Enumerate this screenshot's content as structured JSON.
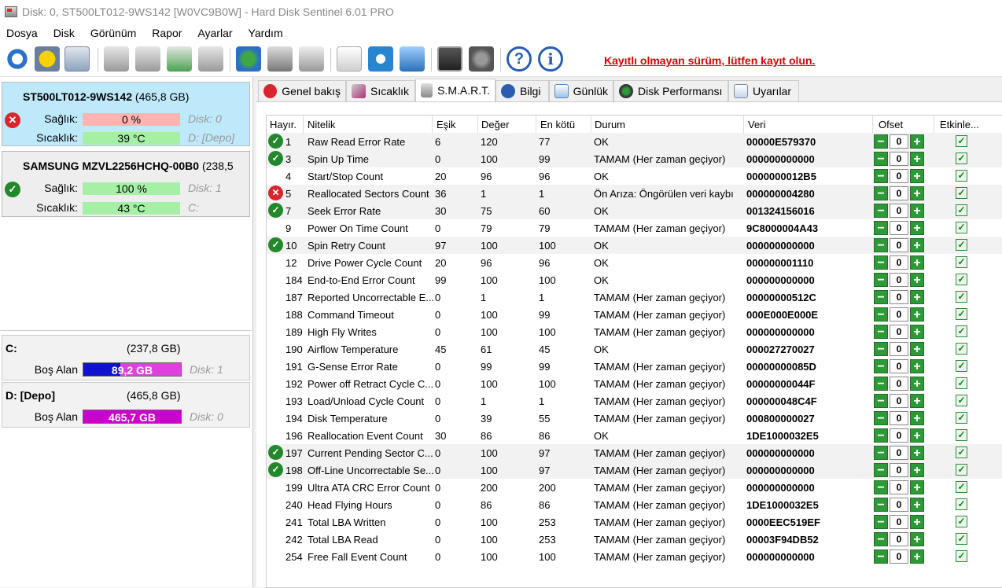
{
  "window": {
    "title": "Disk: 0, ST500LT012-9WS142 [W0VC9B0W]  -  Hard Disk Sentinel 6.01 PRO"
  },
  "menu": [
    "Dosya",
    "Disk",
    "Görünüm",
    "Rapor",
    "Ayarlar",
    "Yardım"
  ],
  "toolbar": {
    "register_text": "Kayıtlı olmayan sürüm, lütfen kayıt olun."
  },
  "disks": [
    {
      "name": "ST500LT012-9WS142",
      "size": "(465,8 GB)",
      "health_label": "Sağlık:",
      "health_value": "0 %",
      "health_disk": "Disk: 0",
      "temp_label": "Sıcaklık:",
      "temp_value": "39 °C",
      "temp_drive": "D: [Depo]",
      "status_icon": "error-icon"
    },
    {
      "name": "SAMSUNG MZVL2256HCHQ-00B0",
      "size": "(238,5",
      "health_label": "Sağlık:",
      "health_value": "100 %",
      "health_disk": "Disk: 1",
      "temp_label": "Sıcaklık:",
      "temp_value": "43 °C",
      "temp_drive": "C:",
      "status_icon": "ok-icon"
    }
  ],
  "volumes": [
    {
      "name": "C:",
      "size": "(237,8 GB)",
      "free_label": "Boş Alan",
      "free_value": "89,2 GB",
      "disk": "Disk: 1",
      "color": "#0000cc"
    },
    {
      "name": "D: [Depo]",
      "size": "(465,8 GB)",
      "free_label": "Boş Alan",
      "free_value": "465,7 GB",
      "disk": "Disk: 0",
      "color": "#cc00cc"
    }
  ],
  "tabs": [
    "Genel bakış",
    "Sıcaklık",
    "S.M.A.R.T.",
    "Bilgi",
    "Günlük",
    "Disk Performansı",
    "Uyarılar"
  ],
  "columns": [
    "Hayır.",
    "Nitelik",
    "Eşik",
    "Değer",
    "En kötü",
    "Durum",
    "Veri",
    "Ofset",
    "Etkinle..."
  ],
  "rows": [
    {
      "icon": "ok",
      "no": "1",
      "name": "Raw Read Error Rate",
      "thr": "6",
      "val": "120",
      "worst": "77",
      "status": "OK",
      "data": "00000E579370"
    },
    {
      "icon": "ok",
      "no": "3",
      "name": "Spin Up Time",
      "thr": "0",
      "val": "100",
      "worst": "99",
      "status": "TAMAM (Her zaman geçiyor)",
      "data": "000000000000"
    },
    {
      "icon": "",
      "no": "4",
      "name": "Start/Stop Count",
      "thr": "20",
      "val": "96",
      "worst": "96",
      "status": "OK",
      "data": "0000000012B5"
    },
    {
      "icon": "bad",
      "no": "5",
      "name": "Reallocated Sectors Count",
      "thr": "36",
      "val": "1",
      "worst": "1",
      "status": "Ön Arıza: Öngörülen veri kaybı",
      "data": "000000004280"
    },
    {
      "icon": "ok",
      "no": "7",
      "name": "Seek Error Rate",
      "thr": "30",
      "val": "75",
      "worst": "60",
      "status": "OK",
      "data": "001324156016"
    },
    {
      "icon": "",
      "no": "9",
      "name": "Power On Time Count",
      "thr": "0",
      "val": "79",
      "worst": "79",
      "status": "TAMAM (Her zaman geçiyor)",
      "data": "9C8000004A43"
    },
    {
      "icon": "ok",
      "no": "10",
      "name": "Spin Retry Count",
      "thr": "97",
      "val": "100",
      "worst": "100",
      "status": "OK",
      "data": "000000000000"
    },
    {
      "icon": "",
      "no": "12",
      "name": "Drive Power Cycle Count",
      "thr": "20",
      "val": "96",
      "worst": "96",
      "status": "OK",
      "data": "000000001110"
    },
    {
      "icon": "",
      "no": "184",
      "name": "End-to-End Error Count",
      "thr": "99",
      "val": "100",
      "worst": "100",
      "status": "OK",
      "data": "000000000000"
    },
    {
      "icon": "",
      "no": "187",
      "name": "Reported Uncorrectable E...",
      "thr": "0",
      "val": "1",
      "worst": "1",
      "status": "TAMAM (Her zaman geçiyor)",
      "data": "00000000512C"
    },
    {
      "icon": "",
      "no": "188",
      "name": "Command Timeout",
      "thr": "0",
      "val": "100",
      "worst": "99",
      "status": "TAMAM (Her zaman geçiyor)",
      "data": "000E000E000E"
    },
    {
      "icon": "",
      "no": "189",
      "name": "High Fly Writes",
      "thr": "0",
      "val": "100",
      "worst": "100",
      "status": "TAMAM (Her zaman geçiyor)",
      "data": "000000000000"
    },
    {
      "icon": "",
      "no": "190",
      "name": "Airflow Temperature",
      "thr": "45",
      "val": "61",
      "worst": "45",
      "status": "OK",
      "data": "000027270027"
    },
    {
      "icon": "",
      "no": "191",
      "name": "G-Sense Error Rate",
      "thr": "0",
      "val": "99",
      "worst": "99",
      "status": "TAMAM (Her zaman geçiyor)",
      "data": "00000000085D"
    },
    {
      "icon": "",
      "no": "192",
      "name": "Power off Retract Cycle C...",
      "thr": "0",
      "val": "100",
      "worst": "100",
      "status": "TAMAM (Her zaman geçiyor)",
      "data": "00000000044F"
    },
    {
      "icon": "",
      "no": "193",
      "name": "Load/Unload Cycle Count",
      "thr": "0",
      "val": "1",
      "worst": "1",
      "status": "TAMAM (Her zaman geçiyor)",
      "data": "000000048C4F"
    },
    {
      "icon": "",
      "no": "194",
      "name": "Disk Temperature",
      "thr": "0",
      "val": "39",
      "worst": "55",
      "status": "TAMAM (Her zaman geçiyor)",
      "data": "000800000027"
    },
    {
      "icon": "",
      "no": "196",
      "name": "Reallocation Event Count",
      "thr": "30",
      "val": "86",
      "worst": "86",
      "status": "OK",
      "data": "1DE1000032E5"
    },
    {
      "icon": "ok",
      "no": "197",
      "name": "Current Pending Sector C...",
      "thr": "0",
      "val": "100",
      "worst": "97",
      "status": "TAMAM (Her zaman geçiyor)",
      "data": "000000000000"
    },
    {
      "icon": "ok",
      "no": "198",
      "name": "Off-Line Uncorrectable Se...",
      "thr": "0",
      "val": "100",
      "worst": "97",
      "status": "TAMAM (Her zaman geçiyor)",
      "data": "000000000000"
    },
    {
      "icon": "",
      "no": "199",
      "name": "Ultra ATA CRC Error Count",
      "thr": "0",
      "val": "200",
      "worst": "200",
      "status": "TAMAM (Her zaman geçiyor)",
      "data": "000000000000"
    },
    {
      "icon": "",
      "no": "240",
      "name": "Head Flying Hours",
      "thr": "0",
      "val": "86",
      "worst": "86",
      "status": "TAMAM (Her zaman geçiyor)",
      "data": "1DE1000032E5"
    },
    {
      "icon": "",
      "no": "241",
      "name": "Total LBA Written",
      "thr": "0",
      "val": "100",
      "worst": "253",
      "status": "TAMAM (Her zaman geçiyor)",
      "data": "0000EEC519EF"
    },
    {
      "icon": "",
      "no": "242",
      "name": "Total LBA Read",
      "thr": "0",
      "val": "100",
      "worst": "253",
      "status": "TAMAM (Her zaman geçiyor)",
      "data": "00003F94DB52"
    },
    {
      "icon": "",
      "no": "254",
      "name": "Free Fall Event Count",
      "thr": "0",
      "val": "100",
      "worst": "100",
      "status": "TAMAM (Her zaman geçiyor)",
      "data": "000000000000"
    }
  ],
  "offset_value": "0",
  "offset_minus": "−",
  "offset_plus": "+",
  "check_mark": "✓",
  "ok_mark": "✓",
  "bad_mark": "✕"
}
